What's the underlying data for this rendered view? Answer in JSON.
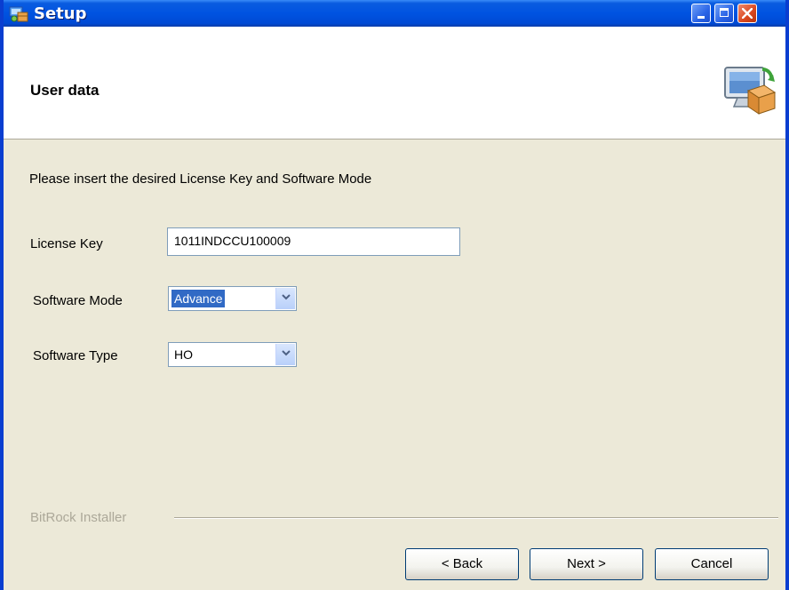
{
  "window": {
    "title": "Setup"
  },
  "header": {
    "title": "User data"
  },
  "form": {
    "instruction": "Please insert the desired License Key and Software Mode",
    "license_key": {
      "label": "License Key",
      "value": "1011INDCCU100009"
    },
    "software_mode": {
      "label": "Software Mode",
      "selected": "Advance"
    },
    "software_type": {
      "label": "Software Type",
      "selected": "HO"
    }
  },
  "footer": {
    "brand": "BitRock Installer",
    "back_label": "< Back",
    "next_label": "Next >",
    "cancel_label": "Cancel"
  },
  "colors": {
    "titlebar": "#0053e1",
    "window_bg": "#ece9d8",
    "selection": "#316ac5",
    "close_button": "#d9471e"
  },
  "icons": {
    "app": "setup-installer-icon",
    "header": "computer-with-package-icon",
    "dropdown": "chevron-down-icon"
  }
}
